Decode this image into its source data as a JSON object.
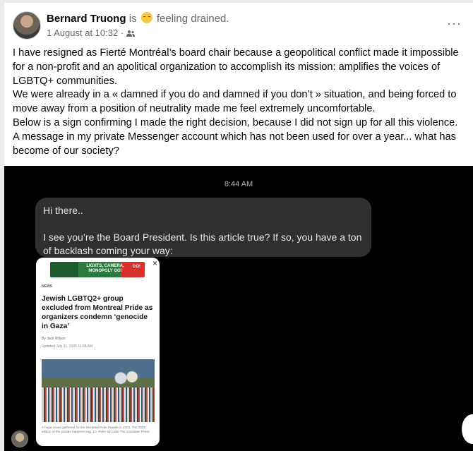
{
  "post": {
    "author": "Bernard Truong",
    "is_text": "is",
    "feeling": "feeling drained.",
    "date": "1 August at 10:32",
    "separator": "·",
    "more": "···",
    "paragraphs": [
      "I have resigned as Fierté Montréal’s board chair because a geopolitical conflict made it impossible for a non-profit and an apolitical organization to accomplish its mission: amplifies the voices of LGBTQ+ communities.",
      "We were already in a « damned if you do and damned if you don’t » situation, and being forced to move away from a position of neutrality made me feel extremely uncomfortable.",
      "Below is a sign confirming I made the right decision, because I did not sign up for all this violence.",
      "A message in my private Messenger account which has not been used for over a year... what has become of our society?"
    ]
  },
  "screenshot": {
    "time": "8:44 AM",
    "message_line1": "Hi there..",
    "message_line2": "I see you’re the Board President. Is this article true? If so, you have a ton of backlash coming your way:",
    "card": {
      "ad_text": "LIGHTS, CAMERA, MONOPOLY GO!",
      "ad_go": "GO!",
      "close": "×",
      "news_label": "NEWS",
      "headline": "Jewish LGBTQ2+ group excluded from Montreal Pride as organizers condemn ‘genocide in Gaza’",
      "byline": "By Jack Wilson",
      "updated": "Updated July 31, 2025 11:38 AM",
      "caption": "A huge crowd gathered for the Montreal Pride Parade in 2023. The 2025 edition of the parade happens Aug. 10. Peter McCabe The Canadian Press"
    }
  }
}
